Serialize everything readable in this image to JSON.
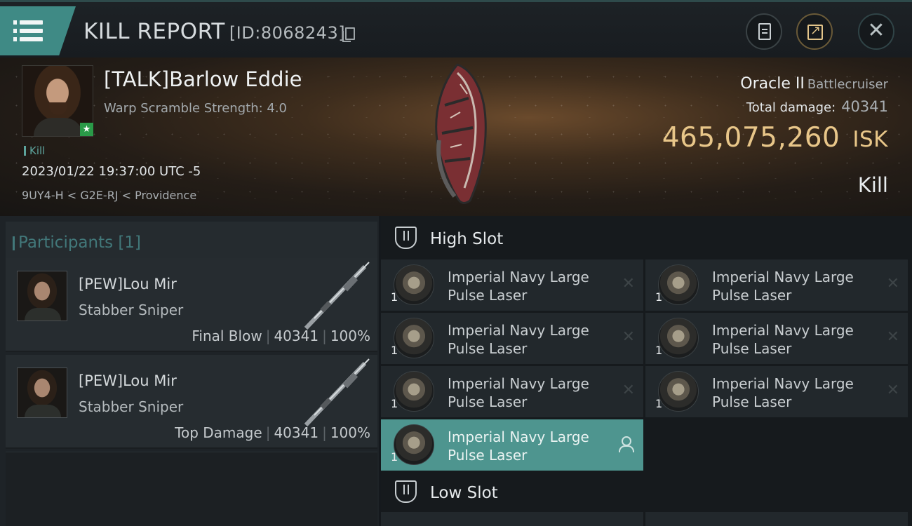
{
  "header": {
    "title": "KILL REPORT",
    "report_id": "[ID:8068243]"
  },
  "victim": {
    "name": "[TALK]Barlow Eddie",
    "warp_scramble": "Warp Scramble Strength: 4.0",
    "kill_tag": "Kill",
    "datetime": "2023/01/22 19:37:00 UTC -5",
    "location": "9UY4-H < G2E-RJ < Providence"
  },
  "ship": {
    "name": "Oracle II",
    "class": "Battlecruiser",
    "total_damage_label": "Total damage:",
    "total_damage": "40341",
    "isk_value": "465,075,260",
    "isk_unit": "ISK",
    "result": "Kill"
  },
  "participants": {
    "header": "Participants",
    "count": "[1]",
    "rows": [
      {
        "name": "[PEW]Lou Mir",
        "ship": "Stabber Sniper",
        "role": "Final Blow",
        "damage": "40341",
        "percent": "100%"
      },
      {
        "name": "[PEW]Lou Mir",
        "ship": "Stabber Sniper",
        "role": "Top Damage",
        "damage": "40341",
        "percent": "100%"
      }
    ]
  },
  "high_slot": {
    "title": "High Slot",
    "items": [
      {
        "qty": "1",
        "name": "Imperial Navy Large Pulse Laser"
      },
      {
        "qty": "1",
        "name": "Imperial Navy Large Pulse Laser"
      },
      {
        "qty": "1",
        "name": "Imperial Navy Large Pulse Laser"
      },
      {
        "qty": "1",
        "name": "Imperial Navy Large Pulse Laser"
      },
      {
        "qty": "1",
        "name": "Imperial Navy Large Pulse Laser"
      },
      {
        "qty": "1",
        "name": "Imperial Navy Large Pulse Laser"
      },
      {
        "qty": "1",
        "name": "Imperial Navy Large Pulse Laser"
      }
    ]
  },
  "low_slot": {
    "title": "Low Slot"
  },
  "icons": {
    "menu": "hamburger-icon",
    "copy": "copy-icon",
    "report": "document-icon",
    "share": "share-icon",
    "close": "close-icon",
    "slot": "shield-icon",
    "destroyed": "x-icon",
    "dropped": "user-icon"
  },
  "colors": {
    "accent": "#3f8a85",
    "isk": "#e8c689",
    "highlight_item": "#4e958f"
  }
}
